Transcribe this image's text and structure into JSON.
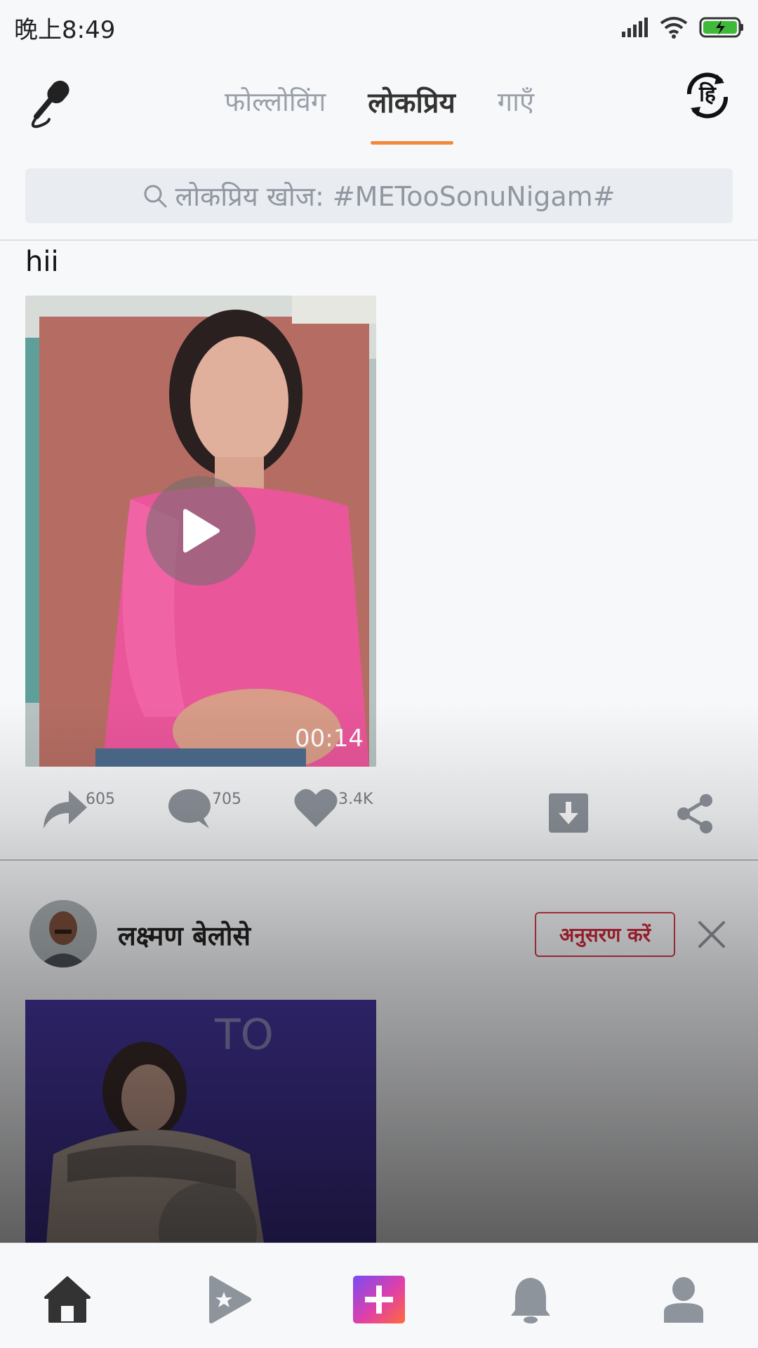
{
  "status_bar": {
    "time": "晚上8:49"
  },
  "tabs": [
    {
      "label": "फोल्लोविंग",
      "active": false
    },
    {
      "label": "लोकप्रिय",
      "active": true
    },
    {
      "label": "गाएँ",
      "active": false
    }
  ],
  "lang_button": {
    "label": "हि"
  },
  "search": {
    "placeholder": "लोकप्रिय खोज: #METooSonuNigam#"
  },
  "post1": {
    "text": "hii",
    "video_duration": "00:14",
    "actions": {
      "repost_count": "605",
      "comment_count": "705",
      "like_count": "3.4K"
    }
  },
  "post2": {
    "username": "लक्ष्मण बेलोसे",
    "follow_label": "अनुसरण करें"
  },
  "colors": {
    "accent": "#f28a3c",
    "follow": "#c8283a",
    "icon_gray": "#8e949c",
    "battery_green": "#3fb93a"
  },
  "icons": [
    "microphone-icon",
    "language-switch-icon",
    "search-icon",
    "play-icon",
    "repost-icon",
    "comment-icon",
    "like-icon",
    "download-icon",
    "share-icon",
    "close-icon",
    "home-icon",
    "video-star-icon",
    "create-icon",
    "notification-icon",
    "profile-icon"
  ]
}
